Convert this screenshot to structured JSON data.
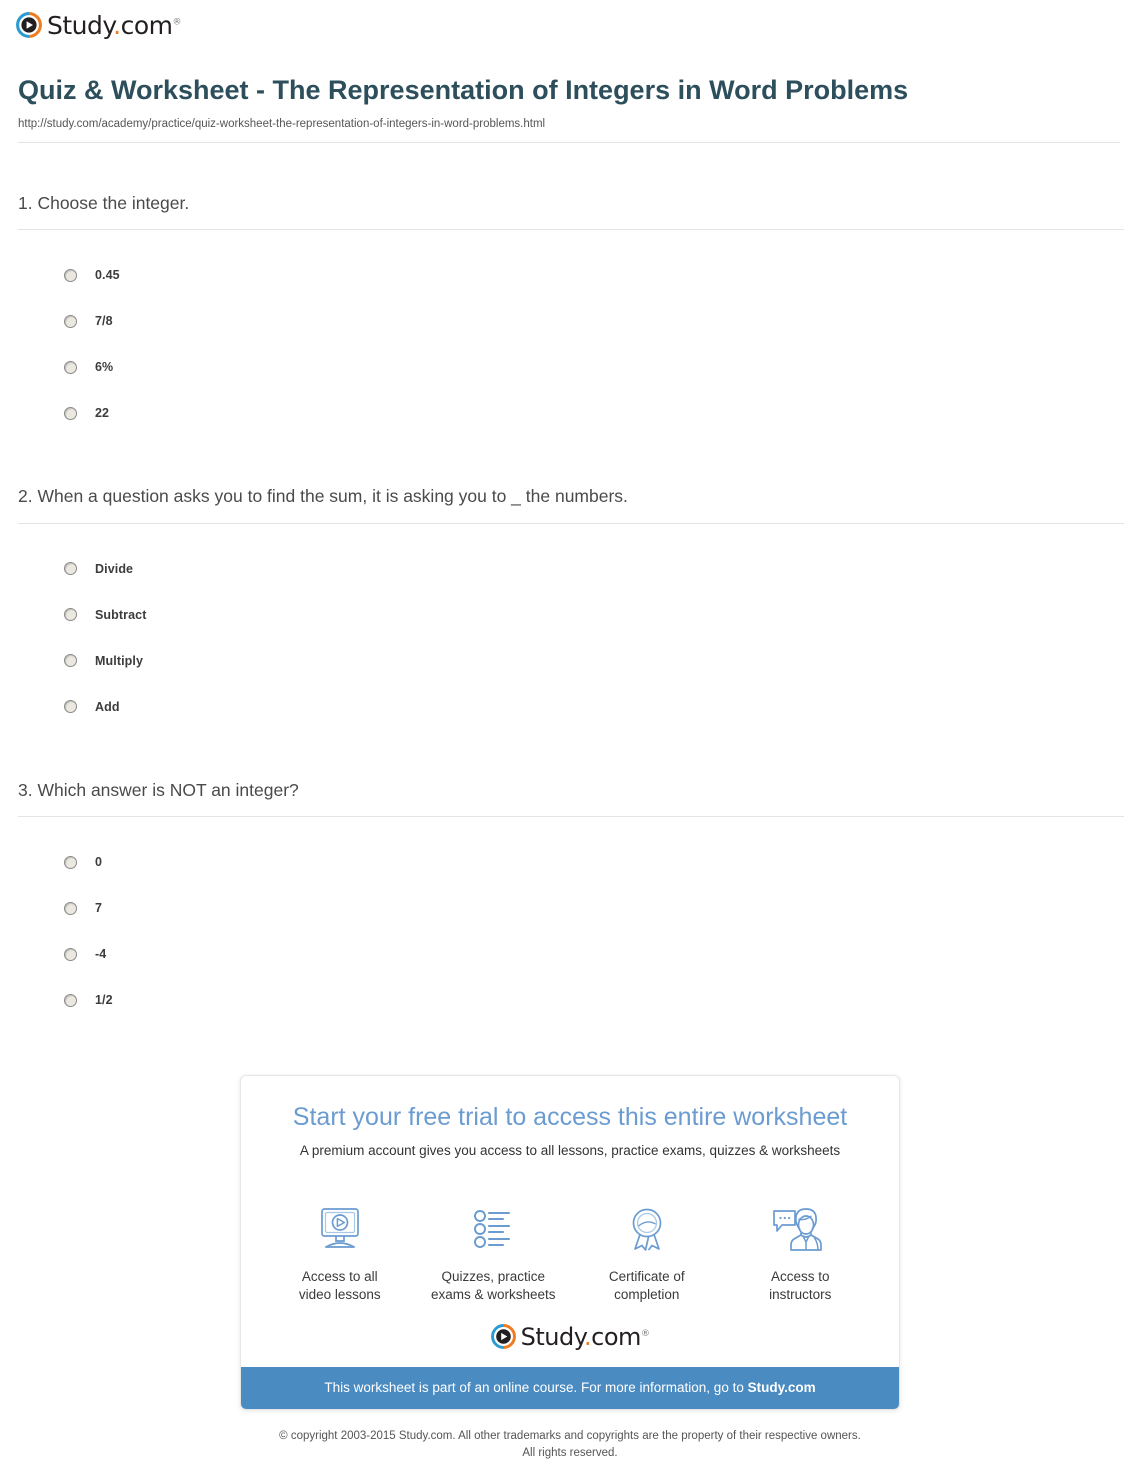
{
  "brand": {
    "name_main": "Study",
    "name_dot": ".",
    "name_tld": "com",
    "trademark": "®",
    "color_blue": "#2d9bd0",
    "color_orange": "#f07c22",
    "color_text": "#231f20"
  },
  "document": {
    "title": "Quiz & Worksheet - The Representation of Integers in Word Problems",
    "url": "http://study.com/academy/practice/quiz-worksheet-the-representation-of-integers-in-word-problems.html",
    "title_color": "#2d4f5c"
  },
  "questions": [
    {
      "text": "1. Choose the integer.",
      "options": [
        {
          "label": "0.45"
        },
        {
          "label": "7/8"
        },
        {
          "label": "6%"
        },
        {
          "label": "22"
        }
      ]
    },
    {
      "text": "2. When a question asks you to find the sum, it is asking you to _ the numbers.",
      "options": [
        {
          "label": "Divide"
        },
        {
          "label": "Subtract"
        },
        {
          "label": "Multiply"
        },
        {
          "label": "Add"
        }
      ]
    },
    {
      "text": "3. Which answer is NOT an integer?",
      "options": [
        {
          "label": "0"
        },
        {
          "label": "7"
        },
        {
          "label": "-4"
        },
        {
          "label": "1/2"
        }
      ]
    }
  ],
  "promo": {
    "title": "Start your free trial to access this entire worksheet",
    "subtitle": "A premium account gives you access to all lessons, practice exams, quizzes & worksheets",
    "title_color": "#6a9bd1",
    "features": [
      {
        "icon": "video-monitor-icon",
        "label": "Access to all\nvideo lessons",
        "line1": "Access to all",
        "line2": "video lessons"
      },
      {
        "icon": "checklist-icon",
        "label": "Quizzes, practice\nexams & worksheets",
        "line1": "Quizzes, practice",
        "line2": "exams & worksheets"
      },
      {
        "icon": "award-ribbon-icon",
        "label": "Certificate of\ncompletion",
        "line1": "Certificate of",
        "line2": "completion"
      },
      {
        "icon": "instructor-chat-icon",
        "label": "Access to\ninstructors",
        "line1": "Access to",
        "line2": "instructors"
      }
    ],
    "banner_text": "This worksheet is part of an online course. For more information, go to ",
    "banner_link": "Study.com",
    "banner_color": "#4a8bc2"
  },
  "footer": {
    "line1": "© copyright 2003-2015 Study.com. All other trademarks and copyrights are the property of their respective owners.",
    "line2": "All rights reserved."
  }
}
